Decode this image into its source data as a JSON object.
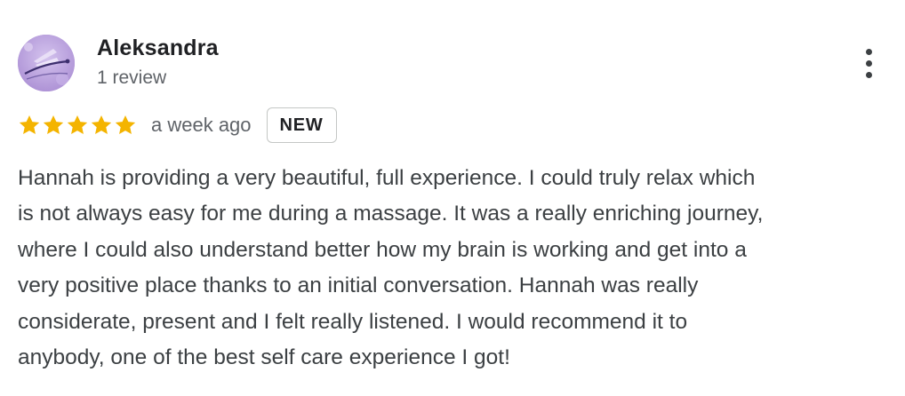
{
  "review": {
    "author": {
      "name": "Aleksandra",
      "review_count": "1 review",
      "avatar_icon": "dragonfly-avatar-icon"
    },
    "rating": {
      "stars": 5,
      "max_stars": 5,
      "star_color": "#f4b400"
    },
    "timestamp": "a week ago",
    "badge": "NEW",
    "text": "Hannah is providing a very beautiful, full experience. I could truly relax which\nis not always easy for me during a massage. It was a really enriching journey,\nwhere I could also understand better how my brain is working and get into a\nvery positive place thanks to an initial conversation. Hannah was really\nconsiderate, present and I felt really listened. I would recommend it to\nanybody, one of the best self care experience I got!",
    "more_menu_icon": "more-vert-icon"
  }
}
